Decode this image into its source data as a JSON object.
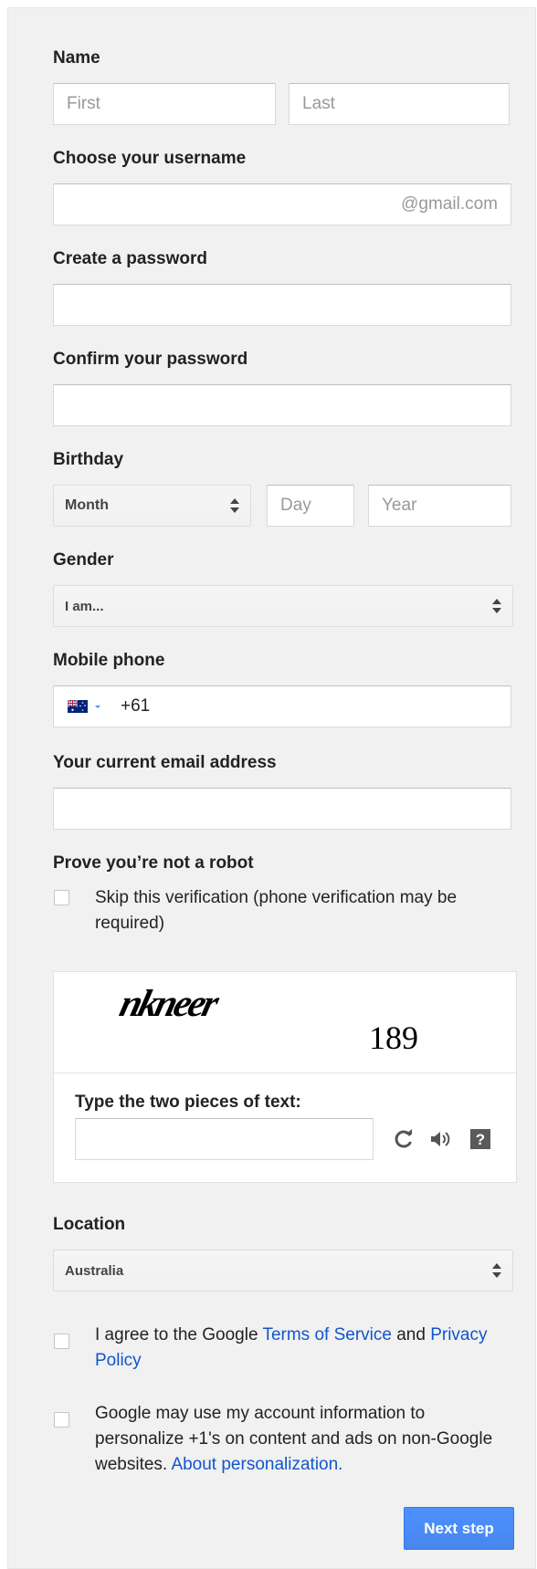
{
  "name": {
    "label": "Name",
    "first_placeholder": "First",
    "last_placeholder": "Last"
  },
  "username": {
    "label": "Choose your username",
    "suffix": "@gmail.com"
  },
  "password": {
    "label": "Create a password"
  },
  "confirm_password": {
    "label": "Confirm your password"
  },
  "birthday": {
    "label": "Birthday",
    "month": "Month",
    "day_placeholder": "Day",
    "year_placeholder": "Year"
  },
  "gender": {
    "label": "Gender",
    "selected": "I am..."
  },
  "mobile_phone": {
    "label": "Mobile phone",
    "country_flag": "australia-flag-icon",
    "value": "+61"
  },
  "current_email": {
    "label": "Your current email address"
  },
  "robot": {
    "label": "Prove you’re not a robot",
    "skip_text": "Skip this verification (phone verification may be required)"
  },
  "captcha": {
    "word1": "nkneer",
    "word2": "189",
    "instruction": "Type the two pieces of text:",
    "icons": [
      "refresh-icon",
      "audio-icon",
      "help-icon"
    ],
    "help_glyph": "?"
  },
  "location": {
    "label": "Location",
    "selected": "Australia"
  },
  "terms": {
    "prefix": "I agree to the Google ",
    "tos_link": "Terms of Service",
    "and": " and ",
    "privacy_link": "Privacy Policy"
  },
  "personalization": {
    "text": "Google may use my account information to personalize +1's on content and ads on non-Google websites. ",
    "link": "About personalization."
  },
  "next_button": "Next step"
}
